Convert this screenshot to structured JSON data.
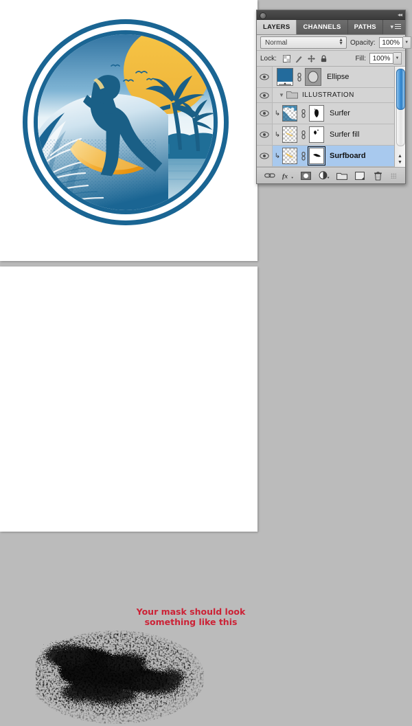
{
  "app": {
    "background_color": "#bbbbbb"
  },
  "documents": {
    "top": {
      "name": "surf-badge-document",
      "artwork_title": "Surfer badge illustration"
    },
    "bottom": {
      "name": "mask-preview-document"
    }
  },
  "annotation": {
    "line1": "Your mask should look",
    "line2": "something like this",
    "color": "#cc2236"
  },
  "panel": {
    "title": "Layers panel",
    "tabs": [
      {
        "label": "LAYERS",
        "active": true
      },
      {
        "label": "CHANNELS",
        "active": false
      },
      {
        "label": "PATHS",
        "active": false
      }
    ],
    "menu_icon": "panel-menu-icon",
    "collapse_icon": "collapse-to-icons-icon",
    "options": {
      "blend_mode": "Normal",
      "opacity_label": "Opacity:",
      "opacity_value": "100%",
      "lock_label": "Lock:",
      "lock_icons": [
        "lock-transparent-pixels-icon",
        "lock-image-pixels-icon",
        "lock-position-icon",
        "lock-all-icon"
      ],
      "fill_label": "Fill:",
      "fill_value": "100%"
    },
    "layers": [
      {
        "name": "Ellipse",
        "type": "shape",
        "visible": true,
        "selected": false,
        "clipped": false,
        "linked": true,
        "has_vector_mask": true
      },
      {
        "name": "ILLUSTRATION",
        "type": "group",
        "visible": true,
        "selected": false,
        "expanded": true
      },
      {
        "name": "Surfer",
        "type": "pixel",
        "visible": true,
        "selected": false,
        "clipped": true,
        "linked": true,
        "has_layer_mask": true,
        "mask_active": false
      },
      {
        "name": "Surfer fill",
        "type": "pixel",
        "visible": true,
        "selected": false,
        "clipped": true,
        "linked": true,
        "has_layer_mask": true,
        "mask_active": false
      },
      {
        "name": "Surfboard",
        "type": "pixel",
        "visible": true,
        "selected": true,
        "clipped": true,
        "linked": true,
        "has_layer_mask": true,
        "mask_active": true
      }
    ],
    "scrollbar": {
      "name": "layers-scrollbar",
      "thumb_position": "top"
    },
    "footer_icons": [
      "link-layers-icon",
      "layer-styles-fx-icon",
      "add-layer-mask-icon",
      "new-adjustment-layer-icon",
      "new-group-icon",
      "new-layer-icon",
      "delete-layer-icon"
    ]
  }
}
